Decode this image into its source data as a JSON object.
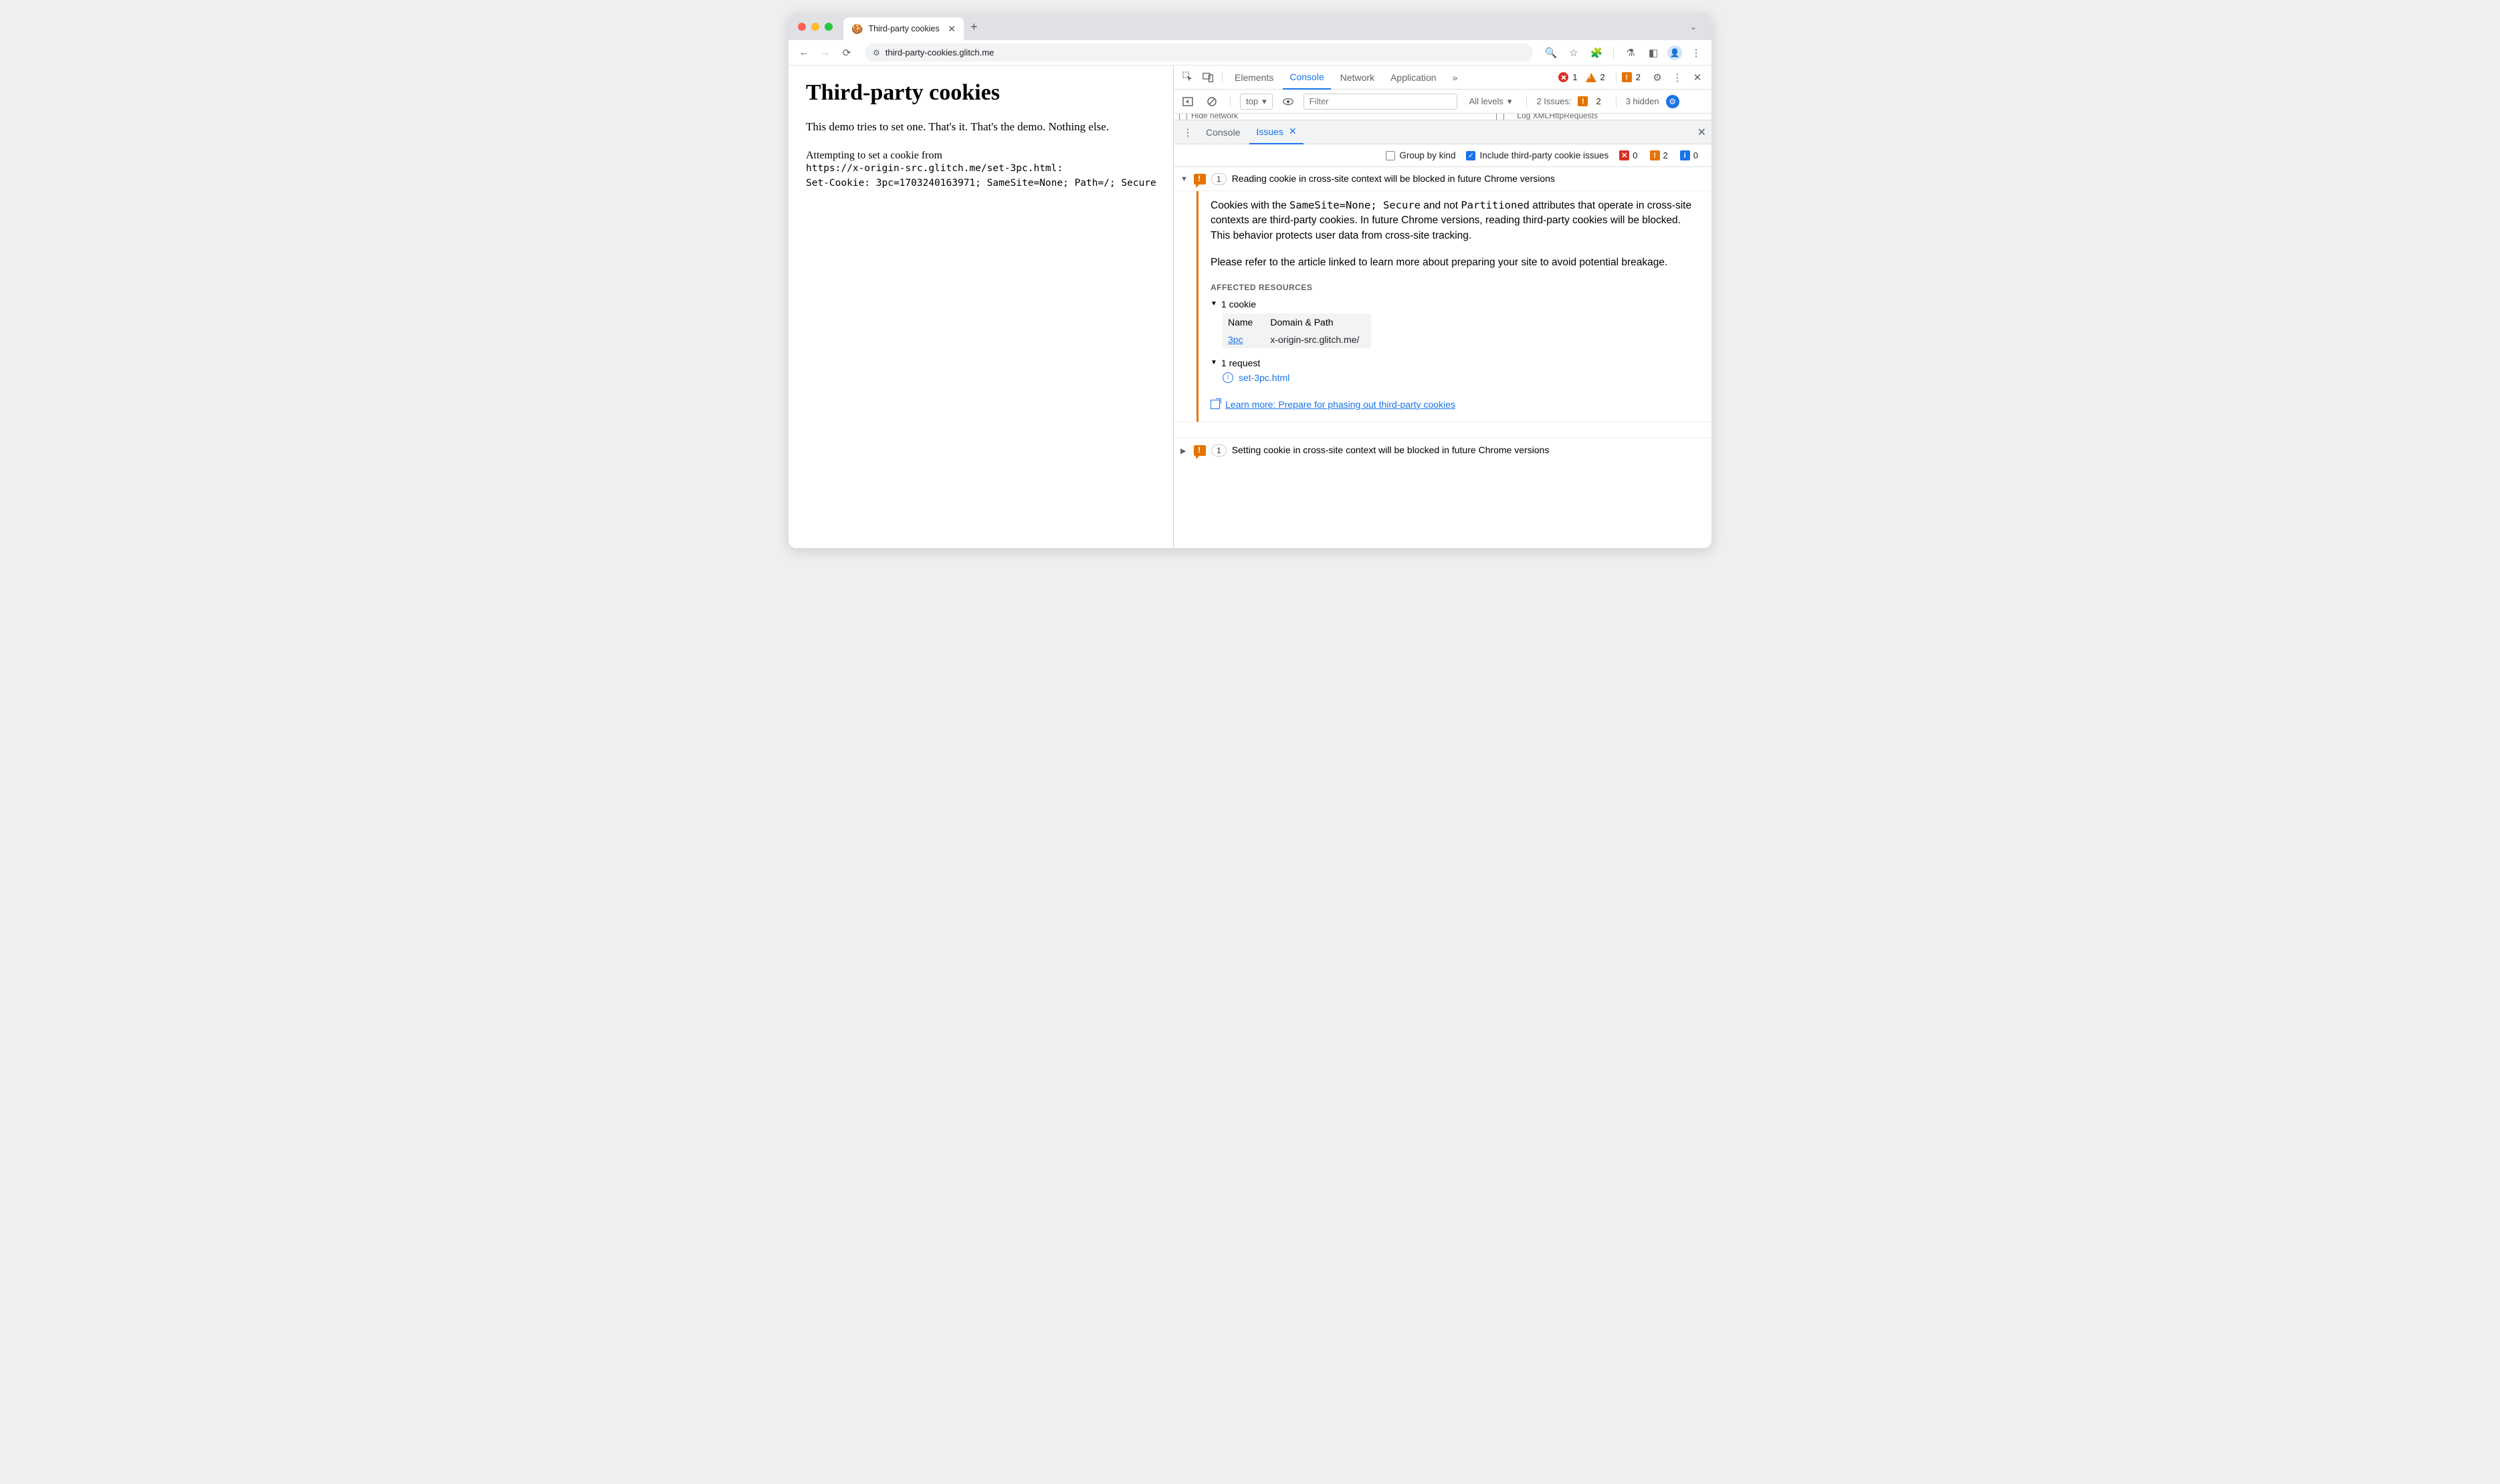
{
  "browser": {
    "tab_title": "Third-party cookies",
    "url": "third-party-cookies.glitch.me"
  },
  "page": {
    "heading": "Third-party cookies",
    "lead": "This demo tries to set one. That's it. That's the demo. Nothing else.",
    "attempt_line": "Attempting to set a cookie from",
    "attempt_url": "https://x-origin-src.glitch.me/set-3pc.html:",
    "set_cookie": "Set-Cookie: 3pc=1703240163971; SameSite=None; Path=/; Secure"
  },
  "devtools": {
    "tabs": {
      "elements": "Elements",
      "console": "Console",
      "network": "Network",
      "application": "Application",
      "more": "»"
    },
    "status": {
      "errors": "1",
      "warnings": "2",
      "issues": "2"
    },
    "filter": {
      "top": "top",
      "placeholder": "Filter",
      "levels": "All levels",
      "issues_label": "2 Issues:",
      "issues_count": "2",
      "hidden": "3 hidden"
    },
    "sliver": {
      "left": "Hide network",
      "right": "Log XMLHttpRequests"
    },
    "drawer": {
      "console": "Console",
      "issues": "Issues"
    },
    "issues_bar": {
      "group": "Group by kind",
      "include": "Include third-party cookie issues",
      "count_red": "0",
      "count_orange": "2",
      "count_blue": "0"
    },
    "issue1": {
      "count": "1",
      "title": "Reading cookie in cross-site context will be blocked in future Chrome versions",
      "p1a": "Cookies with the ",
      "code1": "SameSite=None; Secure",
      "p1b": " and not ",
      "code2": "Partitioned",
      "p1c": " attributes that operate in cross-site contexts are third-party cookies. In future Chrome versions, reading third-party cookies will be blocked. This behavior protects user data from cross-site tracking.",
      "p2": "Please refer to the article linked to learn more about preparing your site to avoid potential breakage.",
      "affected": "AFFECTED RESOURCES",
      "cookie_hdr": "1 cookie",
      "th_name": "Name",
      "th_dp": "Domain & Path",
      "td_name": "3pc",
      "td_dp": "x-origin-src.glitch.me/",
      "req_hdr": "1 request",
      "req_name": "set-3pc.html",
      "learn": "Learn more: Prepare for phasing out third-party cookies"
    },
    "issue2": {
      "count": "1",
      "title": "Setting cookie in cross-site context will be blocked in future Chrome versions"
    }
  }
}
